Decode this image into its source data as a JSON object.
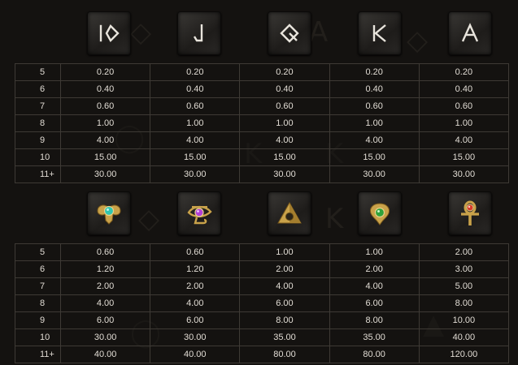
{
  "sections": [
    {
      "symbols": [
        {
          "icon": "rune-10-icon"
        },
        {
          "icon": "rune-j-icon"
        },
        {
          "icon": "rune-q-icon"
        },
        {
          "icon": "rune-k-icon"
        },
        {
          "icon": "rune-a-icon"
        }
      ],
      "rows": [
        {
          "count": "5",
          "payouts": [
            "0.20",
            "0.20",
            "0.20",
            "0.20",
            "0.20"
          ]
        },
        {
          "count": "6",
          "payouts": [
            "0.40",
            "0.40",
            "0.40",
            "0.40",
            "0.40"
          ]
        },
        {
          "count": "7",
          "payouts": [
            "0.60",
            "0.60",
            "0.60",
            "0.60",
            "0.60"
          ]
        },
        {
          "count": "8",
          "payouts": [
            "1.00",
            "1.00",
            "1.00",
            "1.00",
            "1.00"
          ]
        },
        {
          "count": "9",
          "payouts": [
            "4.00",
            "4.00",
            "4.00",
            "4.00",
            "4.00"
          ]
        },
        {
          "count": "10",
          "payouts": [
            "15.00",
            "15.00",
            "15.00",
            "15.00",
            "15.00"
          ]
        },
        {
          "count": "11+",
          "payouts": [
            "30.00",
            "30.00",
            "30.00",
            "30.00",
            "30.00"
          ]
        }
      ]
    },
    {
      "symbols": [
        {
          "icon": "scarab-icon",
          "gem": "#2fc6b0"
        },
        {
          "icon": "eye-of-horus-icon",
          "gem": "#b23fd8"
        },
        {
          "icon": "pyramid-icon",
          "gem": "#e2c04a"
        },
        {
          "icon": "cobra-icon",
          "gem": "#2ea23a"
        },
        {
          "icon": "ankh-icon",
          "gem": "#d83a2a"
        }
      ],
      "rows": [
        {
          "count": "5",
          "payouts": [
            "0.60",
            "0.60",
            "1.00",
            "1.00",
            "2.00"
          ]
        },
        {
          "count": "6",
          "payouts": [
            "1.20",
            "1.20",
            "2.00",
            "2.00",
            "3.00"
          ]
        },
        {
          "count": "7",
          "payouts": [
            "2.00",
            "2.00",
            "4.00",
            "4.00",
            "5.00"
          ]
        },
        {
          "count": "8",
          "payouts": [
            "4.00",
            "4.00",
            "6.00",
            "6.00",
            "8.00"
          ]
        },
        {
          "count": "9",
          "payouts": [
            "6.00",
            "6.00",
            "8.00",
            "8.00",
            "10.00"
          ]
        },
        {
          "count": "10",
          "payouts": [
            "30.00",
            "30.00",
            "35.00",
            "35.00",
            "40.00"
          ]
        },
        {
          "count": "11+",
          "payouts": [
            "40.00",
            "40.00",
            "80.00",
            "80.00",
            "120.00"
          ]
        }
      ]
    }
  ],
  "colors": {
    "gold": "#c9a24a",
    "rune": "#e8e4dc"
  }
}
